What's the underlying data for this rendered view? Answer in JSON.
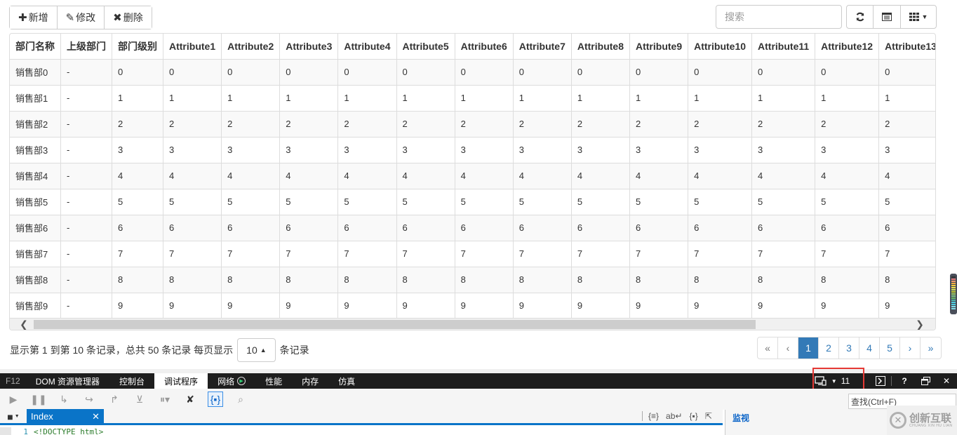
{
  "toolbar": {
    "add_label": "新增",
    "edit_label": "修改",
    "delete_label": "删除",
    "add_icon": "plus-icon",
    "edit_icon": "pencil-icon",
    "delete_icon": "remove-icon"
  },
  "search": {
    "placeholder": "搜索"
  },
  "right_tools": [
    "refresh-icon",
    "toggle-view-icon",
    "columns-icon"
  ],
  "table": {
    "headers": [
      "部门名称",
      "上级部门",
      "部门级别",
      "Attribute1",
      "Attribute2",
      "Attribute3",
      "Attribute4",
      "Attribute5",
      "Attribute6",
      "Attribute7",
      "Attribute8",
      "Attribute9",
      "Attribute10",
      "Attribute11",
      "Attribute12",
      "Attribute13"
    ],
    "rows": [
      [
        "销售部0",
        "-",
        "0",
        "0",
        "0",
        "0",
        "0",
        "0",
        "0",
        "0",
        "0",
        "0",
        "0",
        "0",
        "0",
        "0"
      ],
      [
        "销售部1",
        "-",
        "1",
        "1",
        "1",
        "1",
        "1",
        "1",
        "1",
        "1",
        "1",
        "1",
        "1",
        "1",
        "1",
        "1"
      ],
      [
        "销售部2",
        "-",
        "2",
        "2",
        "2",
        "2",
        "2",
        "2",
        "2",
        "2",
        "2",
        "2",
        "2",
        "2",
        "2",
        "2"
      ],
      [
        "销售部3",
        "-",
        "3",
        "3",
        "3",
        "3",
        "3",
        "3",
        "3",
        "3",
        "3",
        "3",
        "3",
        "3",
        "3",
        "3"
      ],
      [
        "销售部4",
        "-",
        "4",
        "4",
        "4",
        "4",
        "4",
        "4",
        "4",
        "4",
        "4",
        "4",
        "4",
        "4",
        "4",
        "4"
      ],
      [
        "销售部5",
        "-",
        "5",
        "5",
        "5",
        "5",
        "5",
        "5",
        "5",
        "5",
        "5",
        "5",
        "5",
        "5",
        "5",
        "5"
      ],
      [
        "销售部6",
        "-",
        "6",
        "6",
        "6",
        "6",
        "6",
        "6",
        "6",
        "6",
        "6",
        "6",
        "6",
        "6",
        "6",
        "6"
      ],
      [
        "销售部7",
        "-",
        "7",
        "7",
        "7",
        "7",
        "7",
        "7",
        "7",
        "7",
        "7",
        "7",
        "7",
        "7",
        "7",
        "7"
      ],
      [
        "销售部8",
        "-",
        "8",
        "8",
        "8",
        "8",
        "8",
        "8",
        "8",
        "8",
        "8",
        "8",
        "8",
        "8",
        "8",
        "8"
      ],
      [
        "销售部9",
        "-",
        "9",
        "9",
        "9",
        "9",
        "9",
        "9",
        "9",
        "9",
        "9",
        "9",
        "9",
        "9",
        "9",
        "9"
      ]
    ]
  },
  "pagination": {
    "info_prefix": "显示第 1 到第 10 条记录，总共 50 条记录 每页显示",
    "page_size": "10",
    "info_suffix": "条记录",
    "pages": [
      "«",
      "‹",
      "1",
      "2",
      "3",
      "4",
      "5",
      "›",
      "»"
    ],
    "active_page": "1",
    "accent": "#337ab7"
  },
  "devtools": {
    "f12": "F12",
    "tabs": [
      "DOM 资源管理器",
      "控制台",
      "调试程序",
      "网络",
      "性能",
      "内存",
      "仿真"
    ],
    "active_tab": "调试程序",
    "emulation_version": "11",
    "find_placeholder": "查找(Ctrl+F)",
    "file_tab": "Index",
    "watch_title": "监视",
    "code_line_number": "1",
    "code_line": "<!DOCTYPE html>",
    "highlight_color": "#e53935"
  },
  "watermark": {
    "title": "创新互联",
    "subtitle": "CHUANG XIN HU LIAN"
  }
}
